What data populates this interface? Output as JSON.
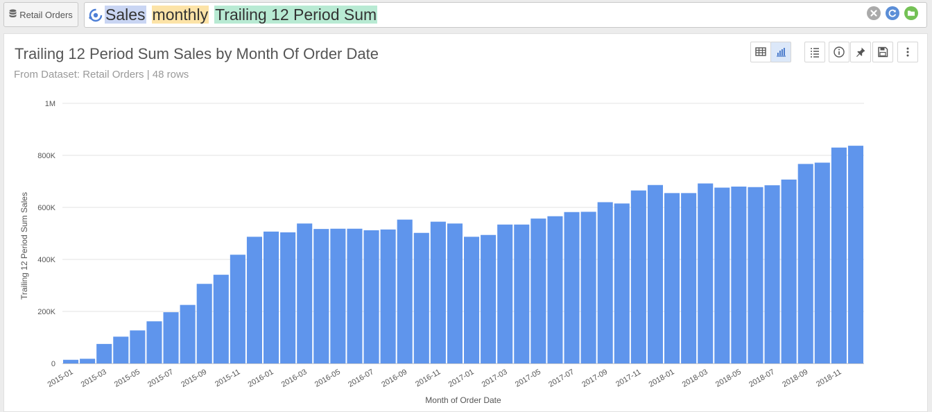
{
  "dataset_button": {
    "label": "Retail Orders",
    "icon": "database-icon"
  },
  "search": {
    "tokens": [
      {
        "text": "Sales",
        "color": "#c9d5f3"
      },
      {
        "text": "monthly",
        "color": "#fce3a7"
      },
      {
        "text": "Trailing 12 Period Sum",
        "color": "#b8ead3"
      }
    ],
    "buttons": [
      "clear-icon",
      "refresh-icon",
      "open-folder-icon"
    ]
  },
  "panel": {
    "title": "Trailing 12 Period Sum Sales by Month Of Order Date",
    "subtitle": "From Dataset: Retail Orders | 48 rows",
    "toolbar": [
      "table-view-icon",
      "chart-view-icon",
      "list-icon",
      "info-icon",
      "pin-icon",
      "save-icon",
      "more-vertical-icon"
    ]
  },
  "chart_data": {
    "type": "bar",
    "xlabel": "Month of Order Date",
    "ylabel": "Trailing 12 Period Sum Sales",
    "ylim": [
      0,
      1000000
    ],
    "yticks": [
      {
        "value": 0,
        "label": "0"
      },
      {
        "value": 200000,
        "label": "200K"
      },
      {
        "value": 400000,
        "label": "400K"
      },
      {
        "value": 600000,
        "label": "600K"
      },
      {
        "value": 800000,
        "label": "800K"
      },
      {
        "value": 1000000,
        "label": "1M"
      }
    ],
    "grid": true,
    "color": "#5f95ec",
    "categories": [
      "2015-01",
      "2015-02",
      "2015-03",
      "2015-04",
      "2015-05",
      "2015-06",
      "2015-07",
      "2015-08",
      "2015-09",
      "2015-10",
      "2015-11",
      "2015-12",
      "2016-01",
      "2016-02",
      "2016-03",
      "2016-04",
      "2016-05",
      "2016-06",
      "2016-07",
      "2016-08",
      "2016-09",
      "2016-10",
      "2016-11",
      "2016-12",
      "2017-01",
      "2017-02",
      "2017-03",
      "2017-04",
      "2017-05",
      "2017-06",
      "2017-07",
      "2017-08",
      "2017-09",
      "2017-10",
      "2017-11",
      "2017-12",
      "2018-01",
      "2018-02",
      "2018-03",
      "2018-04",
      "2018-05",
      "2018-06",
      "2018-07",
      "2018-08",
      "2018-09",
      "2018-10",
      "2018-11",
      "2018-12"
    ],
    "xtick_labels": [
      "2015-01",
      "2015-03",
      "2015-05",
      "2015-07",
      "2015-09",
      "2015-11",
      "2016-01",
      "2016-03",
      "2016-05",
      "2016-07",
      "2016-09",
      "2016-11",
      "2017-01",
      "2017-03",
      "2017-05",
      "2017-07",
      "2017-09",
      "2017-11",
      "2018-01",
      "2018-03",
      "2018-05",
      "2018-07",
      "2018-09",
      "2018-11"
    ],
    "values": [
      14000,
      18000,
      75000,
      103000,
      127000,
      162000,
      197000,
      225000,
      306000,
      341000,
      418000,
      487000,
      507000,
      504000,
      538000,
      517000,
      518000,
      518000,
      512000,
      515000,
      553000,
      502000,
      545000,
      538000,
      487000,
      494000,
      534000,
      534000,
      557000,
      566000,
      582000,
      583000,
      620000,
      615000,
      665000,
      686000,
      655000,
      655000,
      692000,
      676000,
      680000,
      678000,
      685000,
      707000,
      767000,
      772000,
      830000,
      837000
    ]
  }
}
